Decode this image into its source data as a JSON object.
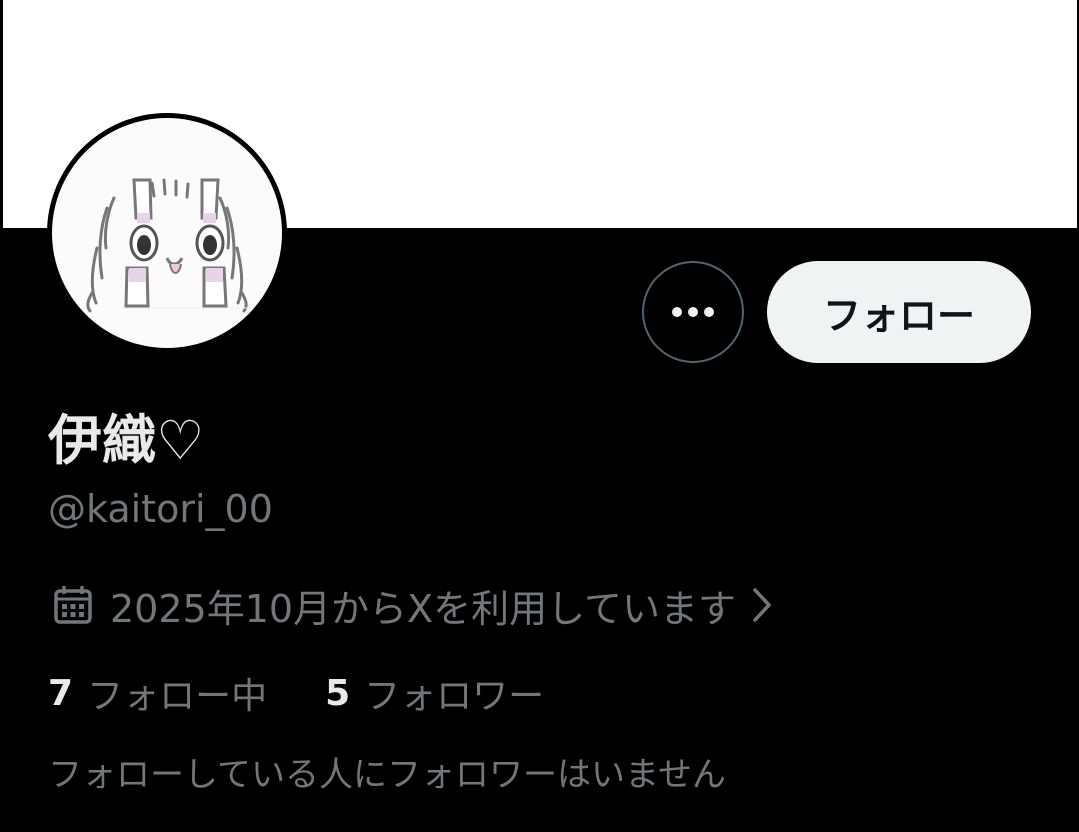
{
  "banner": {
    "color": "#ffffff"
  },
  "avatar": {
    "description_icon": "bunny-drawing"
  },
  "actions": {
    "more_icon": "more-horizontal-icon",
    "follow_label": "フォロー"
  },
  "profile": {
    "display_name": "伊織♡",
    "handle": "@kaitori_00",
    "joined_text": "2025年10月からXを利用しています",
    "joined_icon": "calendar-icon",
    "joined_chevron_icon": "chevron-right-icon"
  },
  "stats": {
    "following_count": "7",
    "following_label": "フォロー中",
    "followers_count": "5",
    "followers_label": "フォロワー"
  },
  "followers_you_know": "フォローしている人にフォロワーはいません",
  "colors": {
    "background": "#000000",
    "primary_text": "#e7e9ea",
    "secondary_text": "#71767b",
    "follow_button_bg": "#eff3f4",
    "border": "#536471"
  }
}
